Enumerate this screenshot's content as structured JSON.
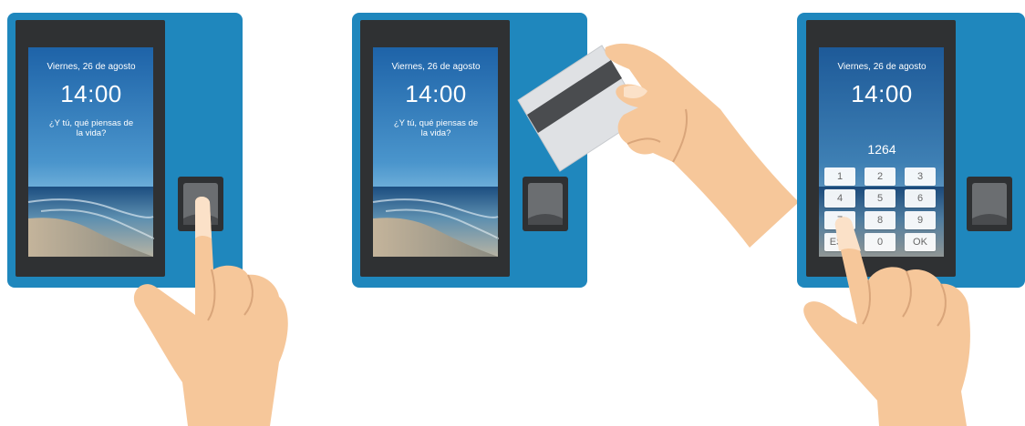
{
  "colors": {
    "terminal": "#1f87bd",
    "bezel": "#2f3133",
    "skin": "#f6c79a",
    "card": "#dfe1e4",
    "stripe": "#4a4c4f"
  },
  "screens": {
    "left": {
      "date": "Viernes, 26 de agosto",
      "time": "14:00",
      "quote": "¿Y tú, qué piensas de la vida?"
    },
    "middle": {
      "date": "Viernes, 26 de agosto",
      "time": "14:00",
      "quote": "¿Y tú, qué piensas de la vida?"
    },
    "right": {
      "date": "Viernes, 26 de agosto",
      "time": "14:00",
      "pin": "1264"
    }
  },
  "keypad": {
    "keys": [
      "1",
      "2",
      "3",
      "4",
      "5",
      "6",
      "7",
      "8",
      "9",
      "ESC",
      "0",
      "OK"
    ]
  },
  "icons": [
    "fingerprint-reader-icon",
    "pointing-hand-icon",
    "magnetic-card-icon",
    "card-hand-icon"
  ]
}
